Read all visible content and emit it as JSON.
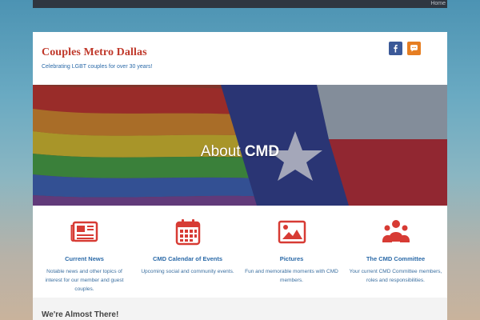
{
  "topbar": {
    "home_link": "Home"
  },
  "header": {
    "site_title": "Couples Metro Dallas",
    "tagline": "Celebrating LGBT couples for over 30 years!",
    "social": [
      {
        "icon": "facebook-icon",
        "color": "#3b5998"
      },
      {
        "icon": "chat-icon",
        "color": "#e67e22"
      }
    ]
  },
  "hero": {
    "title_light": "About ",
    "title_bold": "CMD"
  },
  "features": [
    {
      "icon": "newspaper-icon",
      "title": "Current News",
      "description": "Notable news and other topics of interest for our member and guest couples."
    },
    {
      "icon": "calendar-icon",
      "title": "CMD Calendar of Events",
      "description": "Upcoming social and community events."
    },
    {
      "icon": "picture-icon",
      "title": "Pictures",
      "description": "Fun and memorable moments with CMD members."
    },
    {
      "icon": "group-icon",
      "title": "The CMD Committee",
      "description": "Your current CMD Committee members, roles and responsibilities."
    }
  ],
  "section": {
    "heading": "We're Almost There!"
  },
  "colors": {
    "accent_red": "#d73b34",
    "link_blue": "#2b6aa8"
  }
}
